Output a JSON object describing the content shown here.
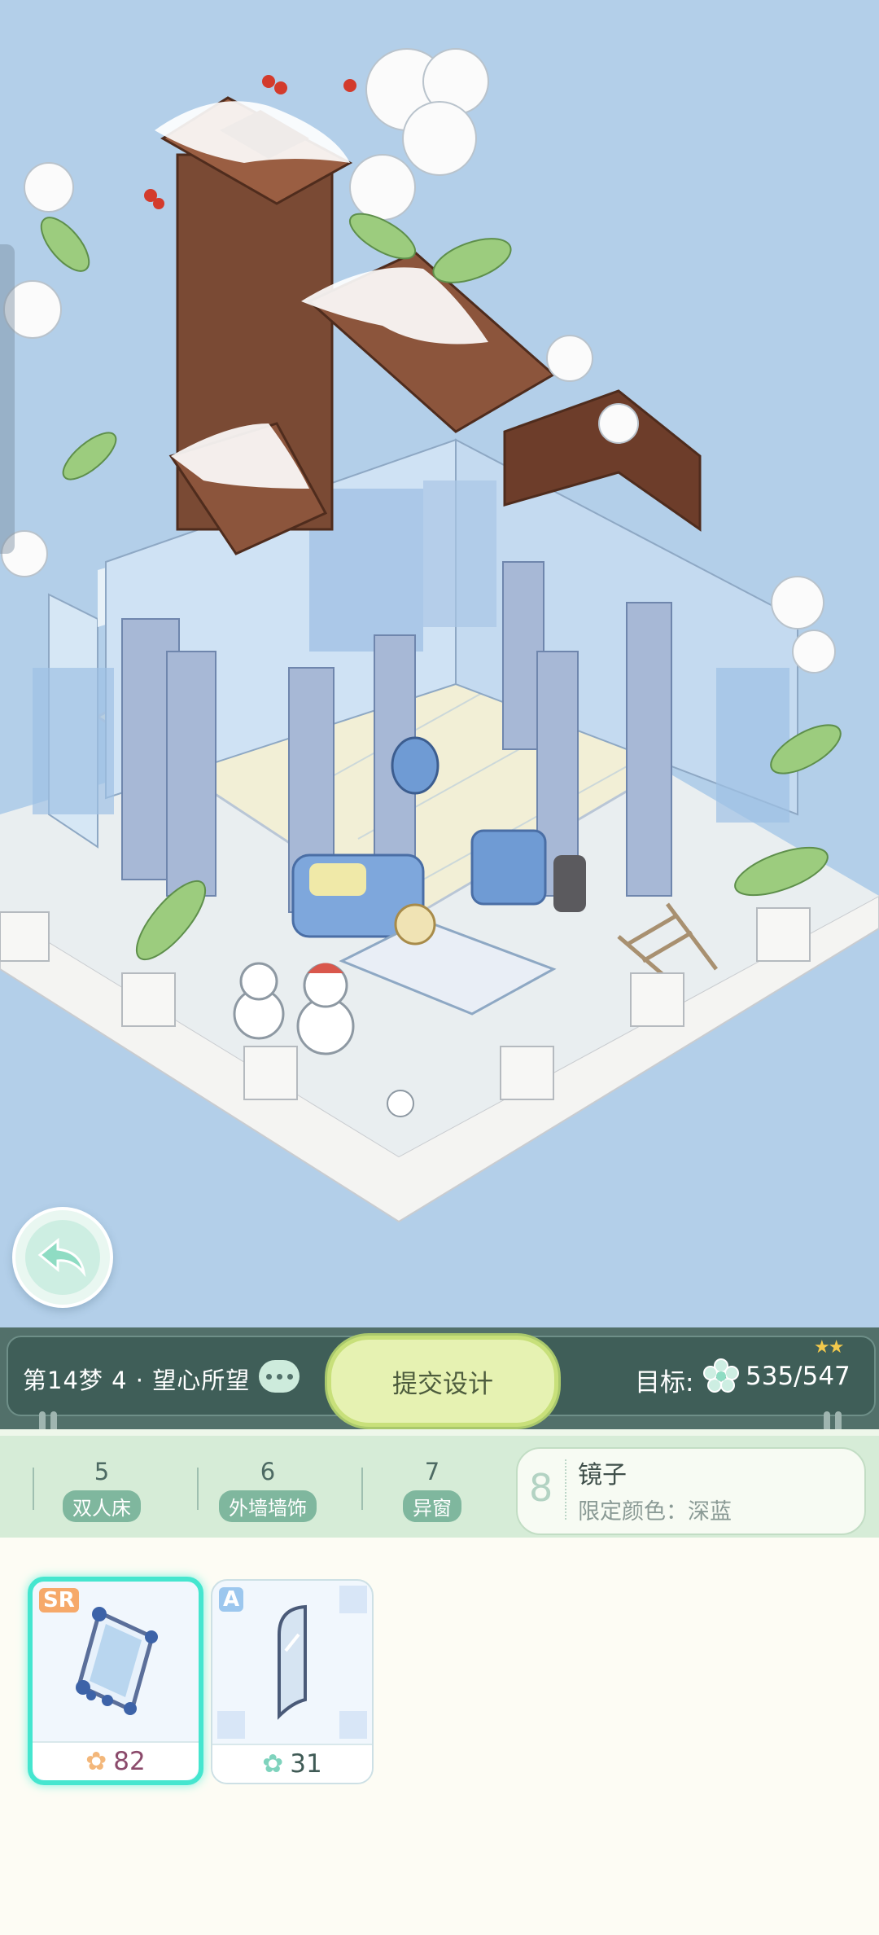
{
  "hud": {
    "level": "第14梦 4 · 望心所望",
    "submit_label": "提交设计",
    "target_label": "目标:",
    "target_value": "535/547",
    "stars": "★★"
  },
  "requirements": [
    {
      "count": "5",
      "name": "双人床"
    },
    {
      "count": "6",
      "name": "外墙墙饰"
    },
    {
      "count": "7",
      "name": "异窗"
    }
  ],
  "goal": {
    "number": "8",
    "title": "镜子",
    "subtitle": "限定颜色：深蓝"
  },
  "items": [
    {
      "rarity": "SR",
      "price": "82",
      "rarity_color": "#f6a96a",
      "price_color": "#8b4a6b"
    },
    {
      "rarity": "A",
      "price": "31",
      "rarity_color": "#9cc7ee",
      "price_color": "#3f5a55"
    }
  ],
  "colors": {
    "sky": "#b3cfe9",
    "hud": "#3f5e58",
    "accent": "#45e6cf"
  }
}
